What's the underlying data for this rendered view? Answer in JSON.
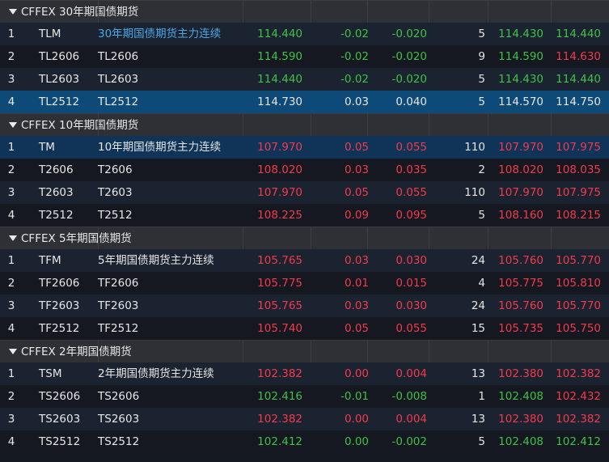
{
  "groups": [
    {
      "title": "CFFEX 30年期国债期货",
      "rows": [
        {
          "idx": "1",
          "code": "TLM",
          "name": "30年期国债期货主力连续",
          "last": "114.440",
          "chg": "-0.02",
          "pct": "-0.020",
          "vol": "5",
          "bid": "114.430",
          "ask": "114.440",
          "last_c": "down",
          "chg_c": "down",
          "pct_c": "down",
          "bid_c": "down",
          "ask_c": "down",
          "name_c": "link"
        },
        {
          "idx": "2",
          "code": "TL2606",
          "name": "TL2606",
          "last": "114.590",
          "chg": "-0.02",
          "pct": "-0.020",
          "vol": "9",
          "bid": "114.590",
          "ask": "114.630",
          "last_c": "down",
          "chg_c": "down",
          "pct_c": "down",
          "bid_c": "down",
          "ask_c": "up",
          "name_c": "flat"
        },
        {
          "idx": "3",
          "code": "TL2603",
          "name": "TL2603",
          "last": "114.440",
          "chg": "-0.02",
          "pct": "-0.020",
          "vol": "5",
          "bid": "114.430",
          "ask": "114.440",
          "last_c": "down",
          "chg_c": "down",
          "pct_c": "down",
          "bid_c": "down",
          "ask_c": "down",
          "name_c": "flat"
        },
        {
          "idx": "4",
          "code": "TL2512",
          "name": "TL2512",
          "last": "114.730",
          "chg": "0.03",
          "pct": "0.040",
          "vol": "5",
          "bid": "114.570",
          "ask": "114.750",
          "last_c": "flat",
          "chg_c": "flat",
          "pct_c": "flat",
          "bid_c": "flat",
          "ask_c": "flat",
          "name_c": "flat"
        }
      ]
    },
    {
      "title": "CFFEX 10年期国债期货",
      "rows": [
        {
          "idx": "1",
          "code": "TM",
          "name": "10年期国债期货主力连续",
          "last": "107.970",
          "chg": "0.05",
          "pct": "0.055",
          "vol": "110",
          "bid": "107.970",
          "ask": "107.975",
          "last_c": "up",
          "chg_c": "up",
          "pct_c": "up",
          "bid_c": "up",
          "ask_c": "up",
          "name_c": "flat"
        },
        {
          "idx": "2",
          "code": "T2606",
          "name": "T2606",
          "last": "108.020",
          "chg": "0.03",
          "pct": "0.035",
          "vol": "2",
          "bid": "108.020",
          "ask": "108.035",
          "last_c": "up",
          "chg_c": "up",
          "pct_c": "up",
          "bid_c": "up",
          "ask_c": "up",
          "name_c": "flat"
        },
        {
          "idx": "3",
          "code": "T2603",
          "name": "T2603",
          "last": "107.970",
          "chg": "0.05",
          "pct": "0.055",
          "vol": "110",
          "bid": "107.970",
          "ask": "107.975",
          "last_c": "up",
          "chg_c": "up",
          "pct_c": "up",
          "bid_c": "up",
          "ask_c": "up",
          "name_c": "flat"
        },
        {
          "idx": "4",
          "code": "T2512",
          "name": "T2512",
          "last": "108.225",
          "chg": "0.09",
          "pct": "0.095",
          "vol": "5",
          "bid": "108.160",
          "ask": "108.215",
          "last_c": "up",
          "chg_c": "up",
          "pct_c": "up",
          "bid_c": "up",
          "ask_c": "up",
          "name_c": "flat"
        }
      ]
    },
    {
      "title": "CFFEX 5年期国债期货",
      "rows": [
        {
          "idx": "1",
          "code": "TFM",
          "name": "5年期国债期货主力连续",
          "last": "105.765",
          "chg": "0.03",
          "pct": "0.030",
          "vol": "24",
          "bid": "105.760",
          "ask": "105.770",
          "last_c": "up",
          "chg_c": "up",
          "pct_c": "up",
          "bid_c": "up",
          "ask_c": "up",
          "name_c": "flat"
        },
        {
          "idx": "2",
          "code": "TF2606",
          "name": "TF2606",
          "last": "105.775",
          "chg": "0.01",
          "pct": "0.015",
          "vol": "4",
          "bid": "105.775",
          "ask": "105.810",
          "last_c": "up",
          "chg_c": "up",
          "pct_c": "up",
          "bid_c": "up",
          "ask_c": "up",
          "name_c": "flat"
        },
        {
          "idx": "3",
          "code": "TF2603",
          "name": "TF2603",
          "last": "105.765",
          "chg": "0.03",
          "pct": "0.030",
          "vol": "24",
          "bid": "105.760",
          "ask": "105.770",
          "last_c": "up",
          "chg_c": "up",
          "pct_c": "up",
          "bid_c": "up",
          "ask_c": "up",
          "name_c": "flat"
        },
        {
          "idx": "4",
          "code": "TF2512",
          "name": "TF2512",
          "last": "105.740",
          "chg": "0.05",
          "pct": "0.055",
          "vol": "15",
          "bid": "105.735",
          "ask": "105.750",
          "last_c": "up",
          "chg_c": "up",
          "pct_c": "up",
          "bid_c": "up",
          "ask_c": "up",
          "name_c": "flat"
        }
      ]
    },
    {
      "title": "CFFEX 2年期国债期货",
      "rows": [
        {
          "idx": "1",
          "code": "TSM",
          "name": "2年期国债期货主力连续",
          "last": "102.382",
          "chg": "0.00",
          "pct": "0.004",
          "vol": "13",
          "bid": "102.380",
          "ask": "102.382",
          "last_c": "up",
          "chg_c": "up",
          "pct_c": "up",
          "bid_c": "up",
          "ask_c": "up",
          "name_c": "flat"
        },
        {
          "idx": "2",
          "code": "TS2606",
          "name": "TS2606",
          "last": "102.416",
          "chg": "-0.01",
          "pct": "-0.008",
          "vol": "1",
          "bid": "102.408",
          "ask": "102.432",
          "last_c": "down",
          "chg_c": "down",
          "pct_c": "down",
          "bid_c": "down",
          "ask_c": "up",
          "name_c": "flat"
        },
        {
          "idx": "3",
          "code": "TS2603",
          "name": "TS2603",
          "last": "102.382",
          "chg": "0.00",
          "pct": "0.004",
          "vol": "13",
          "bid": "102.380",
          "ask": "102.382",
          "last_c": "up",
          "chg_c": "up",
          "pct_c": "up",
          "bid_c": "up",
          "ask_c": "up",
          "name_c": "flat"
        },
        {
          "idx": "4",
          "code": "TS2512",
          "name": "TS2512",
          "last": "102.412",
          "chg": "0.00",
          "pct": "-0.002",
          "vol": "5",
          "bid": "102.408",
          "ask": "102.412",
          "last_c": "down",
          "chg_c": "down",
          "pct_c": "down",
          "bid_c": "down",
          "ask_c": "down",
          "name_c": "flat"
        }
      ]
    }
  ],
  "colors": {
    "up": "#f23a4c",
    "down": "#3ec146",
    "flat": "#e6e6e6",
    "link": "#4aa8e8",
    "selected_row": "#0d4a78",
    "header_bg": "#2e3036"
  }
}
